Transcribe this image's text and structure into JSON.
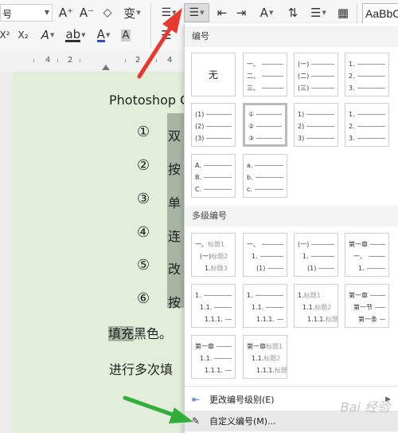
{
  "toolbar": {
    "font_size_text": "号",
    "style_preview_text": "AaBbC",
    "grow_font": "A⁺",
    "shrink_font": "A⁻",
    "clear_format": "⌫",
    "phonetic": "变",
    "superscript": "X²",
    "subscript": "X₂",
    "text_effect": "A",
    "highlight": "ab",
    "font_color": "A",
    "char_shading": "A"
  },
  "ruler": {
    "ticks": [
      "4",
      "2",
      "2",
      "4"
    ]
  },
  "document": {
    "heading": "Photoshop C",
    "items": [
      {
        "num": "①",
        "text": "双"
      },
      {
        "num": "②",
        "text": "按"
      },
      {
        "num": "③",
        "text": "单"
      },
      {
        "num": "④",
        "text": "连"
      },
      {
        "num": "⑤",
        "text": "改"
      },
      {
        "num": "⑥",
        "text": "按"
      }
    ],
    "line_fill_hl": "填充",
    "line_fill_rest": "黑色。",
    "line_repeat": "进行多次填"
  },
  "dropdown": {
    "section_numbering": "编号",
    "section_multilevel": "多级编号",
    "none_label": "无",
    "tiles_numbering": [
      [
        "一、",
        "二、",
        "三、"
      ],
      [
        "(一)",
        "(二)",
        "(三)"
      ],
      [
        "1.",
        "2.",
        "3."
      ],
      [
        "(1)",
        "(2)",
        "(3)"
      ],
      [
        "①",
        "②",
        "③"
      ],
      [
        "1)",
        "2)",
        "3)"
      ],
      [
        "1.",
        "2.",
        "3."
      ],
      [
        "A.",
        "B.",
        "C."
      ],
      [
        "a.",
        "b.",
        "c."
      ]
    ],
    "tiles_multilevel": [
      [
        [
          "一、",
          "标题1"
        ],
        [
          "(一)",
          "标题2"
        ],
        [
          "1.",
          "标题3"
        ]
      ],
      [
        [
          "一、",
          ""
        ],
        [
          "1.",
          ""
        ],
        [
          "(1)",
          ""
        ]
      ],
      [
        [
          "(一)",
          ""
        ],
        [
          "1.",
          ""
        ],
        [
          "(1)",
          ""
        ]
      ],
      [
        [
          "第一章",
          ""
        ],
        [
          "一、",
          ""
        ],
        [
          "1.",
          ""
        ]
      ],
      [
        [
          "1.",
          ""
        ],
        [
          "1.1.",
          ""
        ],
        [
          "1.1.1.",
          ""
        ]
      ],
      [
        [
          "1.",
          ""
        ],
        [
          "1.1.",
          ""
        ],
        [
          "1.1.1.",
          ""
        ]
      ],
      [
        [
          "1.",
          "标题1"
        ],
        [
          "1.1.",
          "标题2"
        ],
        [
          "1.1.1.",
          "标题3"
        ]
      ],
      [
        [
          "第一章",
          ""
        ],
        [
          "第一节",
          ""
        ],
        [
          "第一条",
          ""
        ]
      ],
      [
        [
          "第一章",
          ""
        ],
        [
          "1.1.",
          ""
        ],
        [
          "1.1.1.",
          ""
        ]
      ],
      [
        [
          "第一章",
          "标题1"
        ],
        [
          "1.1.",
          "标题2"
        ],
        [
          "1.1.1.",
          "标题3"
        ]
      ]
    ],
    "change_level": "更改编号级别(E)",
    "custom_numbering": "自定义编号(M)..."
  },
  "watermark": "Bai 经验",
  "colors": {
    "arrow_red": "#e8392e",
    "arrow_green": "#2fae3a",
    "page_bg": "#e2edda",
    "highlight": "#a9b5a3"
  }
}
